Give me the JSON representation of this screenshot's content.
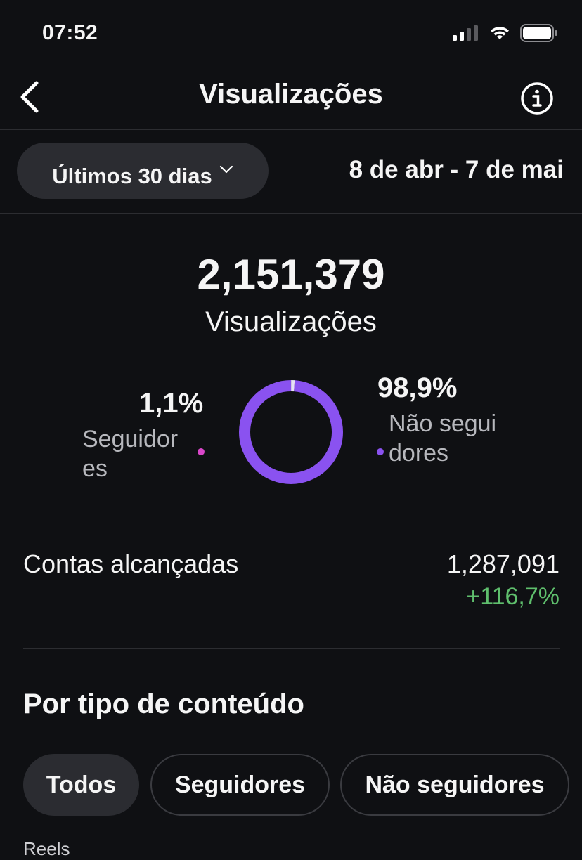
{
  "status_bar": {
    "time": "07:52",
    "signal_icon": "cellular-signal-icon",
    "wifi_icon": "wifi-icon",
    "battery_icon": "battery-icon"
  },
  "header": {
    "title": "Visualizações",
    "back_icon": "chevron-left-icon",
    "info_icon": "info-circle-icon"
  },
  "filter": {
    "range_label": "Últimos 30 dias",
    "dropdown_icon": "chevron-down-icon",
    "date_range": "8 de abr - 7 de mai"
  },
  "summary": {
    "total": "2,151,379",
    "total_label": "Visualizações"
  },
  "breakdown": {
    "followers": {
      "percent": "1,1%",
      "label": "Seguidores",
      "value": 1.1,
      "color": "#d946c9"
    },
    "non_followers": {
      "percent": "98,9%",
      "label": "Não seguidores",
      "value": 98.9,
      "color": "#8a52f0"
    }
  },
  "reach": {
    "label": "Contas alcançadas",
    "value": "1,287,091",
    "change": "+116,7%"
  },
  "content_type": {
    "title": "Por tipo de conteúdo",
    "chips": [
      "Todos",
      "Seguidores",
      "Não seguidores"
    ],
    "active_chip": "Todos",
    "next_section_peek": "Reels"
  },
  "colors": {
    "background": "#0f1013",
    "pill": "#2b2c31",
    "positive": "#5fbf6d"
  }
}
